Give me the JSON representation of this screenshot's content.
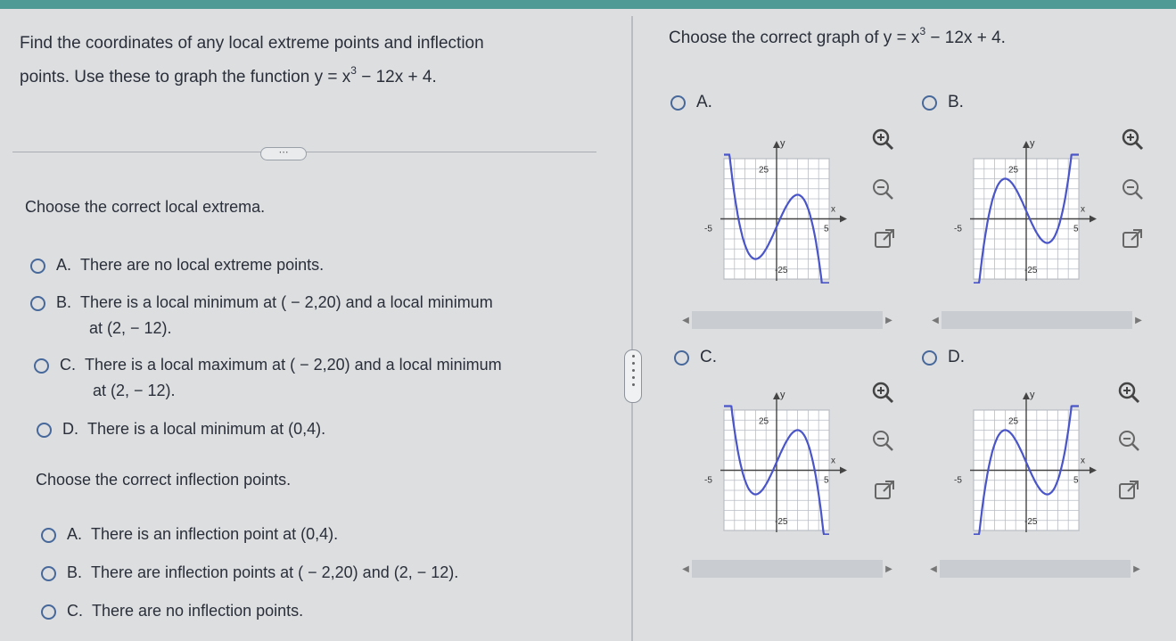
{
  "problem": {
    "line1": "Find the coordinates of any local extreme points and inflection",
    "line2_prefix": "points. Use these to graph the function y = x",
    "exponent": "3",
    "line2_suffix": " − 12x + 4.",
    "more_label": "⋯"
  },
  "extrema": {
    "prompt": "Choose the correct local extrema.",
    "options": [
      {
        "letter": "A.",
        "line1": "There are no local extreme points.",
        "line2": ""
      },
      {
        "letter": "B.",
        "line1": "There is a local minimum at ( − 2,20) and a local minimum",
        "line2": "at (2, − 12)."
      },
      {
        "letter": "C.",
        "line1": "There is a local maximum at ( − 2,20) and a local minimum",
        "line2": "at (2, − 12)."
      },
      {
        "letter": "D.",
        "line1": "There is a local minimum at (0,4).",
        "line2": ""
      }
    ]
  },
  "inflection": {
    "prompt": "Choose the correct inflection points.",
    "options": [
      {
        "letter": "A.",
        "text": "There is an inflection point at (0,4)."
      },
      {
        "letter": "B.",
        "text": "There are inflection points at ( − 2,20) and (2, − 12)."
      },
      {
        "letter": "C.",
        "text": "There are no inflection points."
      }
    ]
  },
  "graph_question": {
    "prefix": "Choose the correct graph of y = x",
    "exponent": "3",
    "suffix": " − 12x + 4.",
    "axis_y": "y",
    "axis_x": "x",
    "tick_pos": "25",
    "tick_neg": "-25",
    "tick_xneg": "-5",
    "tick_xpos": "5",
    "options": [
      {
        "letter": "A."
      },
      {
        "letter": "B."
      },
      {
        "letter": "C."
      },
      {
        "letter": "D."
      }
    ]
  },
  "colors": {
    "curve": "#4a55c8",
    "accent": "#4f9a94",
    "radio": "#47689a"
  }
}
